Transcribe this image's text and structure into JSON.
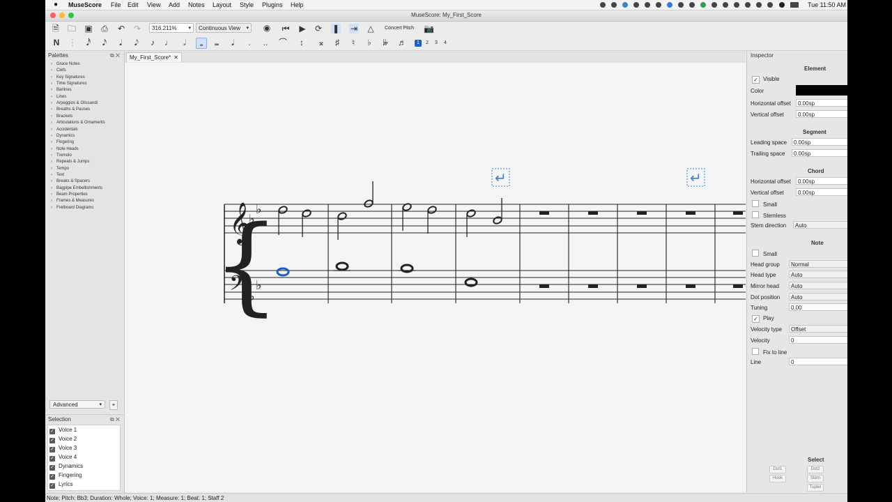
{
  "menubar": {
    "app_name": "MuseScore",
    "items": [
      "File",
      "Edit",
      "View",
      "Add",
      "Notes",
      "Layout",
      "Style",
      "Plugins",
      "Help"
    ],
    "clock": "Tue 11:50 AM"
  },
  "window": {
    "title": "MuseScore: My_First_Score"
  },
  "toolbar": {
    "zoom": "316.211%",
    "view_mode": "Continuous View",
    "concert_pitch": "Concert Pitch",
    "voices": [
      "1",
      "2",
      "3",
      "4"
    ],
    "active_voice": "1"
  },
  "palettes": {
    "title": "Palettes",
    "items": [
      "Grace Notes",
      "Clefs",
      "Key Signatures",
      "Time Signatures",
      "Barlines",
      "Lines",
      "Arpeggios & Glissandi",
      "Breaths & Pauses",
      "Brackets",
      "Articulations & Ornaments",
      "Accidentals",
      "Dynamics",
      "Fingering",
      "Note Heads",
      "Tremolo",
      "Repeats & Jumps",
      "Tempo",
      "Text",
      "Breaks & Spacers",
      "Bagpipe Embellishments",
      "Beam Properties",
      "Frames & Measures",
      "Fretboard Diagrams"
    ],
    "workspace": "Advanced"
  },
  "selection": {
    "title": "Selection",
    "items": [
      "Voice 1",
      "Voice 2",
      "Voice 3",
      "Voice 4",
      "Dynamics",
      "Fingering",
      "Lyrics"
    ]
  },
  "score": {
    "tab_label": "My_First_Score*"
  },
  "inspector": {
    "title": "Inspector",
    "element": {
      "heading": "Element",
      "visible_label": "Visible",
      "color_label": "Color",
      "color_value": "#000000",
      "h_offset_label": "Horizontal offset",
      "h_offset": "0.00sp",
      "v_offset_label": "Vertical offset",
      "v_offset": "0.00sp"
    },
    "segment": {
      "heading": "Segment",
      "leading_label": "Leading space",
      "leading": "0.00sp",
      "trailing_label": "Trailing space",
      "trailing": "0.00sp"
    },
    "chord": {
      "heading": "Chord",
      "h_offset_label": "Horizontal offset",
      "h_offset": "0.00sp",
      "v_offset_label": "Vertical offset",
      "v_offset": "0.00sp",
      "small_label": "Small",
      "stemless_label": "Stemless",
      "stem_dir_label": "Stem direction",
      "stem_dir": "Auto"
    },
    "note": {
      "heading": "Note",
      "small_label": "Small",
      "head_group_label": "Head group",
      "head_group": "Normal",
      "head_type_label": "Head type",
      "head_type": "Auto",
      "mirror_label": "Mirror head",
      "mirror": "Auto",
      "dot_label": "Dot position",
      "dot": "Auto",
      "tuning_label": "Tuning",
      "tuning": "0.00",
      "play_label": "Play",
      "velocity_type_label": "Velocity type",
      "velocity_type": "Offset",
      "velocity_label": "Velocity",
      "velocity": "0",
      "fix_label": "Fix to line",
      "line_label": "Line",
      "line": "0"
    },
    "select": {
      "heading": "Select",
      "buttons": [
        "Dot1",
        "Dot2",
        "Hook",
        "Stem",
        "Tuplet"
      ]
    }
  },
  "status": "Note; Pitch: Bb3; Duration: Whole; Voice: 1;  Measure: 1; Beat: 1; Staff 2",
  "colors": {
    "selection_blue": "#1a5fc4",
    "layout_break": "#3a7fd0"
  }
}
